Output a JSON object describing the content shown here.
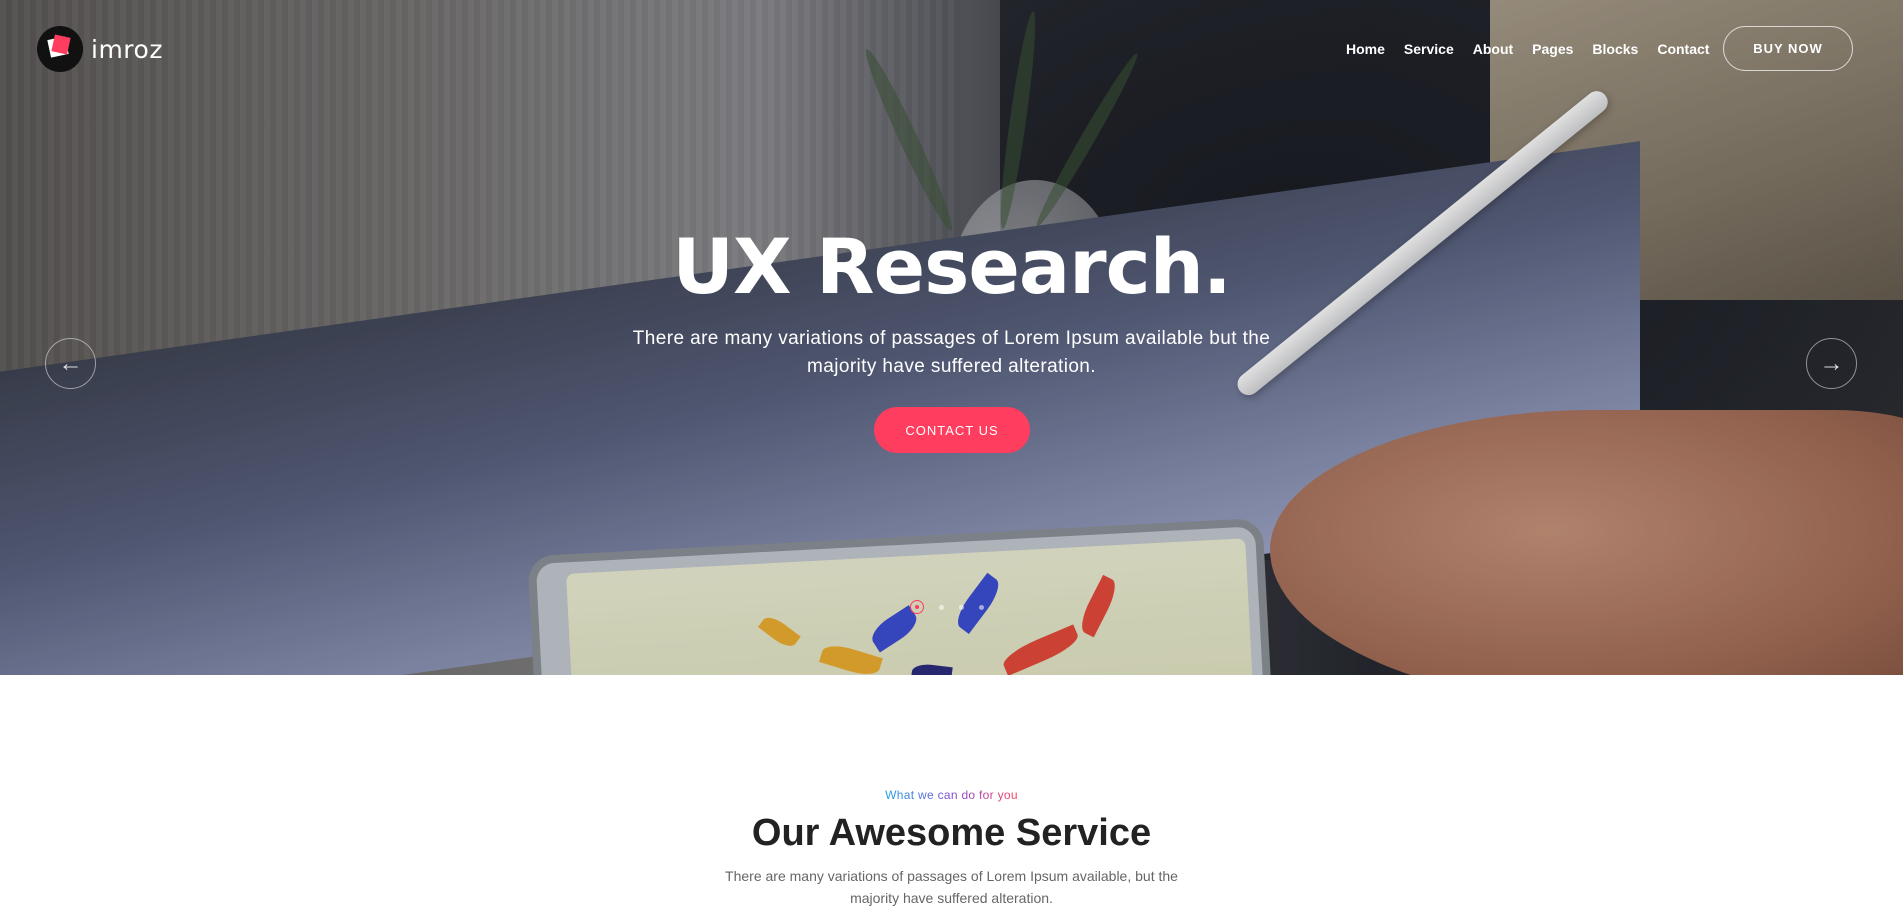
{
  "brand": {
    "name": "imroz"
  },
  "nav": {
    "items": [
      "Home",
      "Service",
      "About",
      "Pages",
      "Blocks",
      "Contact"
    ],
    "cta": "BUY NOW"
  },
  "hero": {
    "title": "UX Research.",
    "subtitle": "There are many variations of passages of Lorem Ipsum available but the majority have suffered alteration.",
    "cta": "CONTACT US",
    "prev_icon": "arrow-left-icon",
    "next_icon": "arrow-right-icon",
    "slides_count": 4,
    "active_slide": 1
  },
  "service": {
    "eyebrow": "What we can do for you",
    "title": "Our Awesome Service",
    "description": "There are many variations of passages of Lorem Ipsum available, but the majority have suffered alteration."
  },
  "colors": {
    "accent": "#ff3d5e",
    "gradient_start": "#1fa2e0",
    "gradient_mid": "#7b4cd6"
  }
}
